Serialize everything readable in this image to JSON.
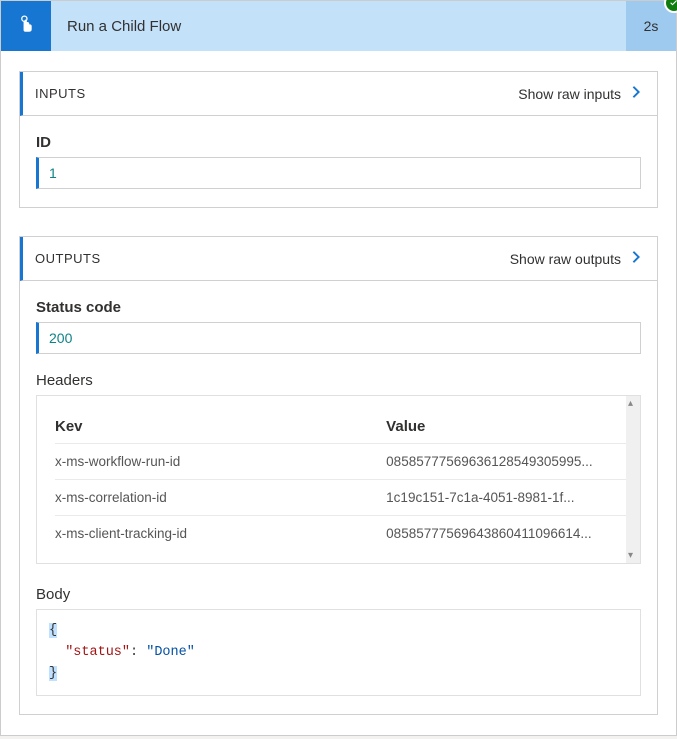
{
  "header": {
    "title": "Run a Child Flow",
    "duration": "2s"
  },
  "inputs": {
    "section_title": "INPUTS",
    "show_raw_label": "Show raw inputs",
    "fields": {
      "id": {
        "label": "ID",
        "value": "1"
      }
    }
  },
  "outputs": {
    "section_title": "OUTPUTS",
    "show_raw_label": "Show raw outputs",
    "status_code": {
      "label": "Status code",
      "value": "200"
    },
    "headers": {
      "label": "Headers",
      "columns": {
        "key": "Kev",
        "value": "Value"
      },
      "rows": [
        {
          "key": "x-ms-workflow-run-id",
          "value": "08585777569636128549305995..."
        },
        {
          "key": "x-ms-correlation-id",
          "value": "1c19c151-7c1a-4051-8981-1f..."
        },
        {
          "key": "x-ms-client-tracking-id",
          "value": "08585777569643860411096614..."
        }
      ]
    },
    "body": {
      "label": "Body",
      "json": {
        "status": "Done"
      },
      "key_display": "\"status\"",
      "val_display": "\"Done\""
    }
  }
}
